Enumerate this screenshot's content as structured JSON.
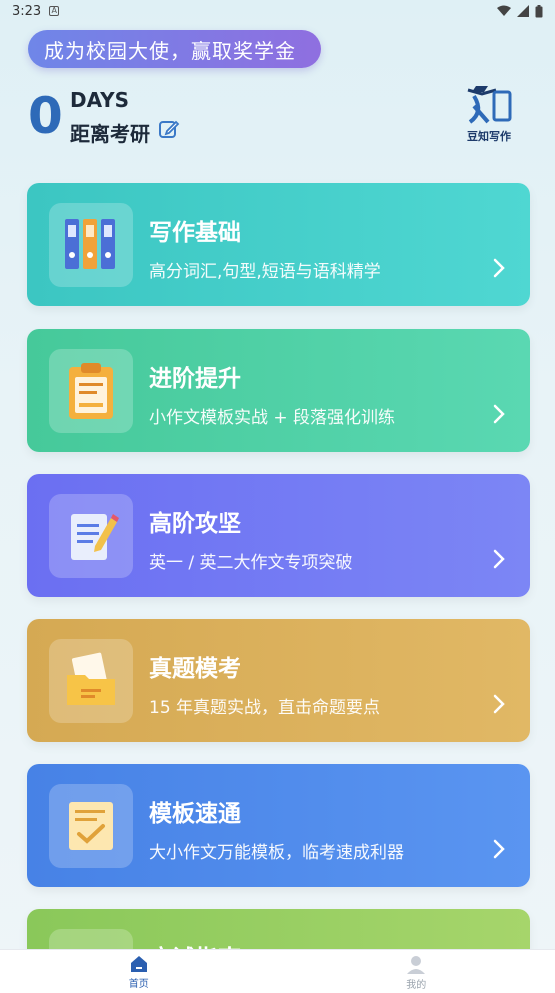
{
  "status_bar": {
    "time": "3:23",
    "notif_icon": "A"
  },
  "banner": {
    "text": "成为校园大使，赢取奖学金"
  },
  "countdown": {
    "number": "0",
    "unit": "DAYS",
    "label": "距离考研"
  },
  "logo": {
    "text": "豆知写作"
  },
  "cards": [
    {
      "title": "写作基础",
      "desc": "高分词汇,句型,短语与语科精学",
      "icon": "binders-icon"
    },
    {
      "title": "进阶提升",
      "desc": "小作文模板实战 + 段落强化训练",
      "icon": "clipboard-icon"
    },
    {
      "title": "高阶攻坚",
      "desc": "英一 / 英二大作文专项突破",
      "icon": "notepad-pencil-icon"
    },
    {
      "title": "真题模考",
      "desc": "15 年真题实战，直击命题要点",
      "icon": "folder-paper-icon"
    },
    {
      "title": "模板速通",
      "desc": "大小作文万能模板，临考速成利器",
      "icon": "checklist-icon"
    },
    {
      "title": "应试指南",
      "desc": "",
      "icon": "guide-icon"
    }
  ],
  "tabs": [
    {
      "label": "首页",
      "icon": "home-icon",
      "active": true
    },
    {
      "label": "我的",
      "icon": "profile-icon",
      "active": false
    }
  ]
}
